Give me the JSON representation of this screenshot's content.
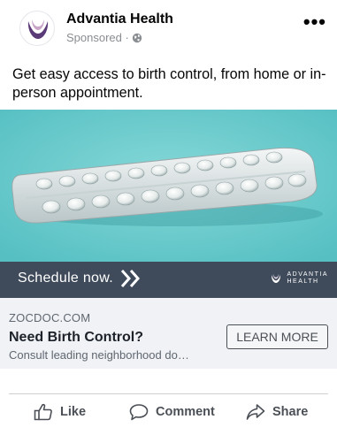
{
  "post": {
    "page_name": "Advantia Health",
    "sponsored": "Sponsored · ",
    "more": "•••",
    "body": "Get easy access to birth control, from home or in-person appointment."
  },
  "ad": {
    "cta_text": "Schedule now.",
    "logo_line1": "ADVANTIA",
    "logo_line2": "HEALTH"
  },
  "link": {
    "domain": "ZOCDOC.COM",
    "headline": "Need Birth Control?",
    "description": "Consult leading neighborhood do…",
    "button": "LEARN MORE"
  },
  "actions": {
    "like": "Like",
    "comment": "Comment",
    "share": "Share"
  },
  "icons": [
    "advantia-logo-icon",
    "globe-icon",
    "more-icon",
    "chevron-right-icon",
    "thumbs-up-icon",
    "comment-icon",
    "share-icon"
  ],
  "colors": {
    "image_bg": "#69c9cb",
    "band_bg": "#3f4b5b",
    "link_bar_bg": "#f0f2f5",
    "logo_purple": "#5b3a78",
    "logo_pink": "#c9a6c8"
  }
}
